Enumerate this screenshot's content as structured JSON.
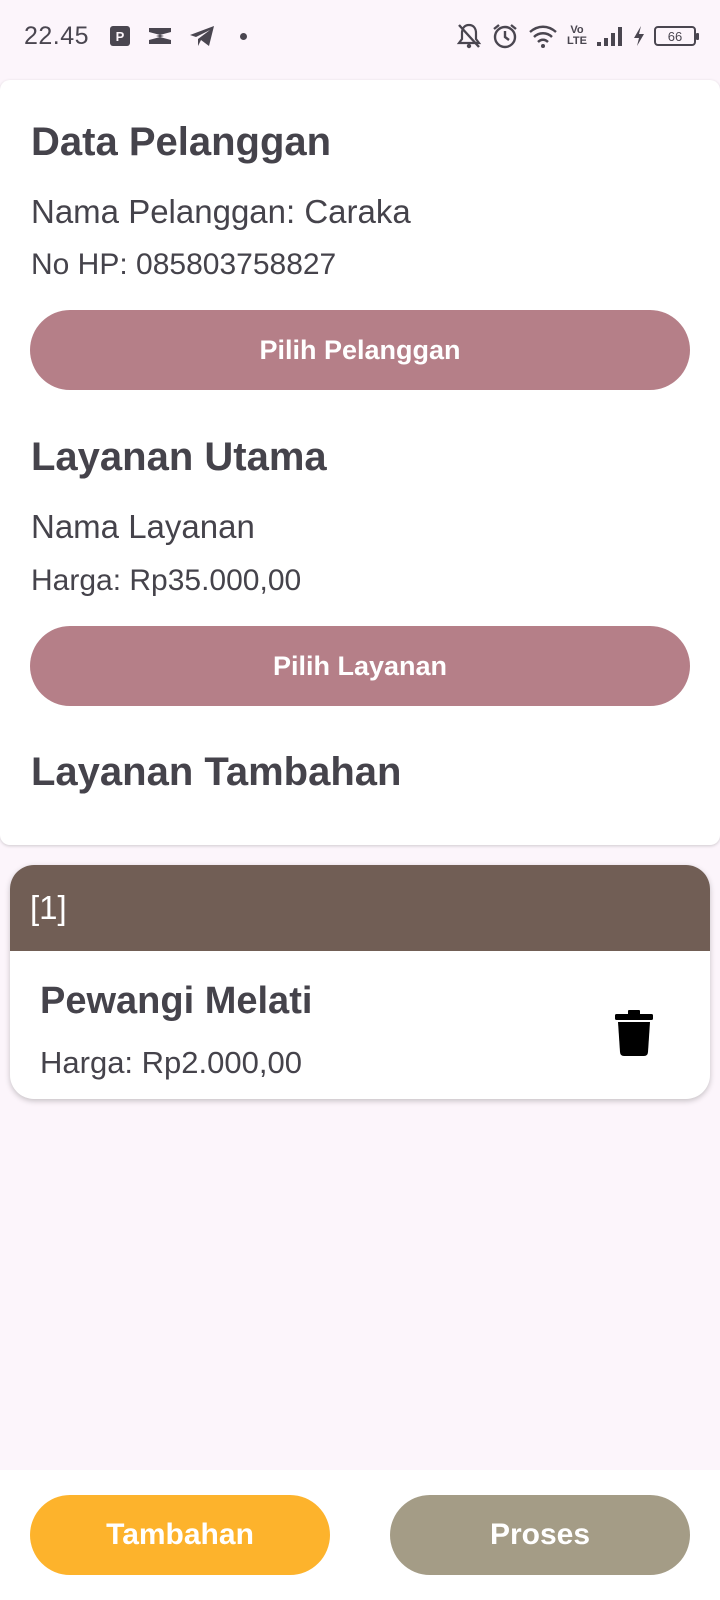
{
  "status_bar": {
    "time": "22.45",
    "battery_level": "66",
    "network_label_top": "Vo",
    "network_label_bottom": "LTE",
    "icons_left": [
      "parking-app-icon",
      "capcut-icon",
      "telegram-icon",
      "notification-dot"
    ],
    "icons_right": [
      "do-not-disturb-icon",
      "alarm-icon",
      "wifi-icon",
      "volte-icon",
      "signal-icon",
      "charging-icon",
      "battery-icon"
    ]
  },
  "customer": {
    "section_title": "Data Pelanggan",
    "name_line": "Nama Pelanggan: Caraka",
    "phone_line": "No HP: 085803758827",
    "select_button": "Pilih Pelanggan"
  },
  "main_service": {
    "section_title": "Layanan Utama",
    "name_line": "Nama Layanan",
    "price_line": "Harga: Rp35.000,00",
    "select_button": "Pilih Layanan"
  },
  "extra_services": {
    "section_title": "Layanan Tambahan",
    "items": [
      {
        "index": "[1]",
        "name": "Pewangi Melati",
        "price": "Harga: Rp2.000,00",
        "delete_icon": "trash-icon"
      }
    ]
  },
  "bottom_actions": {
    "add_button": "Tambahan",
    "process_button": "Proses"
  },
  "colors": {
    "background": "#fcf5fb",
    "primary_button": "#b57f88",
    "item_header": "#715e55",
    "add_button": "#fdb32c",
    "process_button": "#a49c86",
    "text": "#45434b"
  }
}
